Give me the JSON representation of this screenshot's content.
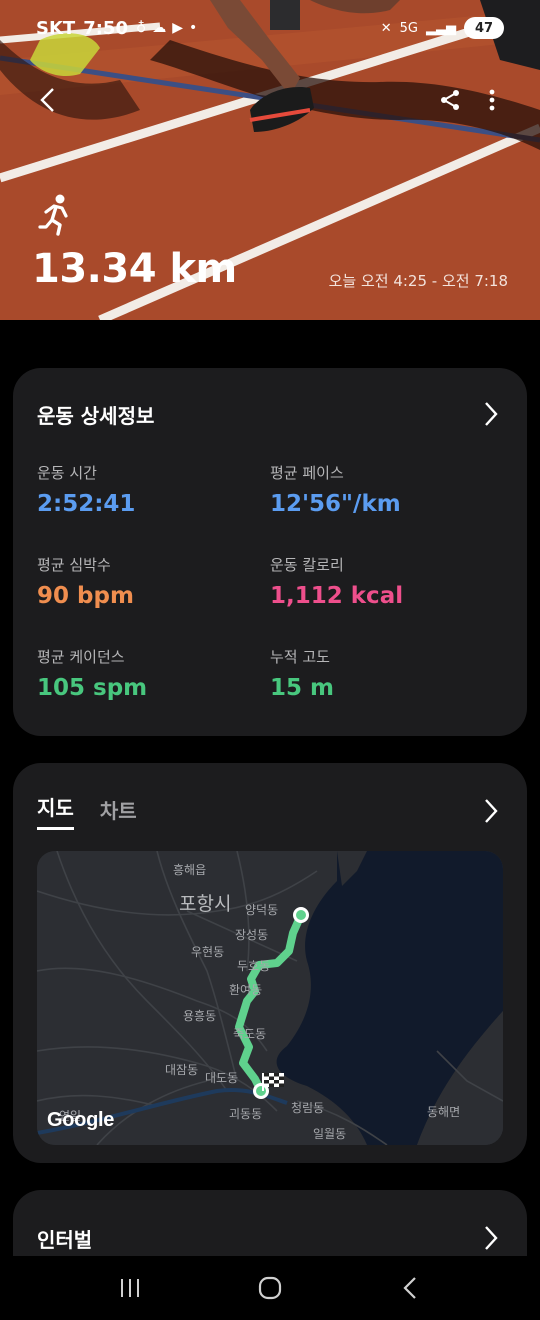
{
  "status_bar": {
    "carrier": "SKT",
    "time": "7:50",
    "left_icons": [
      "person-icon",
      "cloud-icon",
      "youtube-icon",
      "dot-icon"
    ],
    "right_icons": [
      "mute-icon",
      "5g-icon",
      "signal-icon",
      "battery-icon"
    ],
    "network": "5G",
    "battery": "47"
  },
  "header": {
    "back_icon": "chevron-left-icon",
    "share_icon": "share-icon",
    "more_icon": "more-vertical-icon",
    "activity_icon": "running-icon",
    "distance": "13.34 km",
    "time_range": "오늘 오전 4:25 - 오전 7:18"
  },
  "details_card": {
    "title": "운동 상세정보",
    "metrics": [
      {
        "label": "운동 시간",
        "value": "2:52:41",
        "color": "#5b9cf0"
      },
      {
        "label": "평균 페이스",
        "value": "12'56\"/km",
        "color": "#5b9cf0"
      },
      {
        "label": "평균 심박수",
        "value": "90 bpm",
        "color": "#f08e4f"
      },
      {
        "label": "운동 칼로리",
        "value": "1,112 kcal",
        "color": "#ee4f8c"
      },
      {
        "label": "평균 케이던스",
        "value": "105 spm",
        "color": "#48c77e"
      },
      {
        "label": "누적 고도",
        "value": "15 m",
        "color": "#48c77e"
      }
    ]
  },
  "map_card": {
    "tabs": [
      {
        "label": "지도",
        "active": true
      },
      {
        "label": "차트",
        "active": false
      }
    ],
    "route_color": "#5fd18d",
    "map_labels": {
      "city": "포항시",
      "heunghae": "흥해읍",
      "yangdeok": "양덕동",
      "jangseong": "장성동",
      "duho": "두호동",
      "uhyeon": "우현동",
      "hwanyeo": "환여동",
      "yongheung": "용흥동",
      "jukdo": "죽도동",
      "daejam": "대잠동",
      "daedo": "대도동",
      "goedong": "괴동동",
      "cheongnim": "청림동",
      "illwol": "일월동",
      "donghae": "동해면",
      "yeonil": "연일"
    },
    "google_logo": "Google"
  },
  "interval_card": {
    "title": "인터벌"
  },
  "nav_bar": {
    "icons": [
      "recent-apps-icon",
      "home-icon",
      "back-icon"
    ]
  }
}
